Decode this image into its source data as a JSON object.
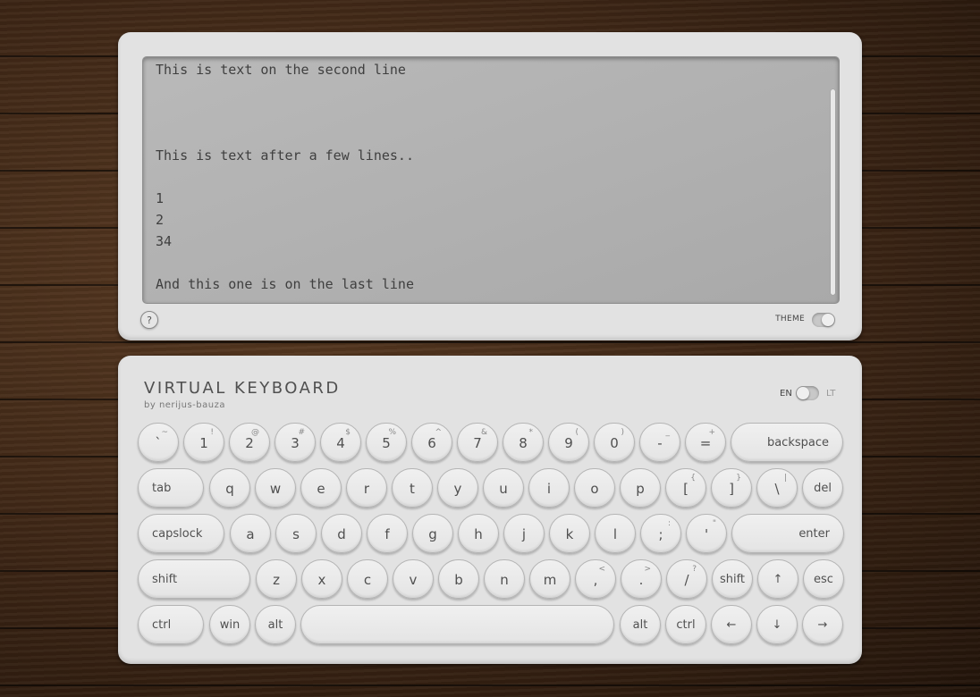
{
  "screen": {
    "text": "This is text on the second line\n\n\n\nThis is text after a few lines..\n\n1\n2\n34\n\nAnd this one is on the last line",
    "help_label": "?",
    "theme_label": "THEME"
  },
  "keyboard": {
    "title": "VIRTUAL KEYBOARD",
    "author": "by nerijus-bauza",
    "lang_en": "EN",
    "lang_lt": "LT",
    "rows": [
      [
        {
          "label": "`",
          "shift": "~"
        },
        {
          "label": "1",
          "shift": "!"
        },
        {
          "label": "2",
          "shift": "@"
        },
        {
          "label": "3",
          "shift": "#"
        },
        {
          "label": "4",
          "shift": "$"
        },
        {
          "label": "5",
          "shift": "%"
        },
        {
          "label": "6",
          "shift": "^"
        },
        {
          "label": "7",
          "shift": "&"
        },
        {
          "label": "8",
          "shift": "*"
        },
        {
          "label": "9",
          "shift": "("
        },
        {
          "label": "0",
          "shift": ")"
        },
        {
          "label": "-",
          "shift": "_"
        },
        {
          "label": "=",
          "shift": "+"
        },
        {
          "label": "backspace",
          "wide": true,
          "align": "right"
        }
      ],
      [
        {
          "label": "tab",
          "wide": true
        },
        {
          "label": "q"
        },
        {
          "label": "w"
        },
        {
          "label": "e"
        },
        {
          "label": "r"
        },
        {
          "label": "t"
        },
        {
          "label": "y"
        },
        {
          "label": "u"
        },
        {
          "label": "i"
        },
        {
          "label": "o"
        },
        {
          "label": "p"
        },
        {
          "label": "[",
          "shift": "{"
        },
        {
          "label": "]",
          "shift": "}"
        },
        {
          "label": "\\",
          "shift": "|"
        },
        {
          "label": "del",
          "mod": true
        }
      ],
      [
        {
          "label": "capslock",
          "wide": true
        },
        {
          "label": "a"
        },
        {
          "label": "s"
        },
        {
          "label": "d"
        },
        {
          "label": "f"
        },
        {
          "label": "g"
        },
        {
          "label": "h"
        },
        {
          "label": "j"
        },
        {
          "label": "k"
        },
        {
          "label": "l"
        },
        {
          "label": ";",
          "shift": ":"
        },
        {
          "label": "'",
          "shift": "\""
        },
        {
          "label": "enter",
          "wide": true,
          "align": "right"
        }
      ],
      [
        {
          "label": "shift",
          "wide": true
        },
        {
          "label": "z"
        },
        {
          "label": "x"
        },
        {
          "label": "c"
        },
        {
          "label": "v"
        },
        {
          "label": "b"
        },
        {
          "label": "n"
        },
        {
          "label": "m"
        },
        {
          "label": ",",
          "shift": "<"
        },
        {
          "label": ".",
          "shift": ">"
        },
        {
          "label": "/",
          "shift": "?"
        },
        {
          "label": "shift",
          "mod": true
        },
        {
          "label": "↑",
          "mod": true
        },
        {
          "label": "esc",
          "mod": true
        }
      ],
      [
        {
          "label": "ctrl",
          "wide": true
        },
        {
          "label": "win",
          "mod": true
        },
        {
          "label": "alt",
          "mod": true
        },
        {
          "label": "",
          "space": true
        },
        {
          "label": "alt",
          "mod": true
        },
        {
          "label": "ctrl",
          "mod": true
        },
        {
          "label": "←",
          "mod": true
        },
        {
          "label": "↓",
          "mod": true
        },
        {
          "label": "→",
          "mod": true
        }
      ]
    ]
  }
}
